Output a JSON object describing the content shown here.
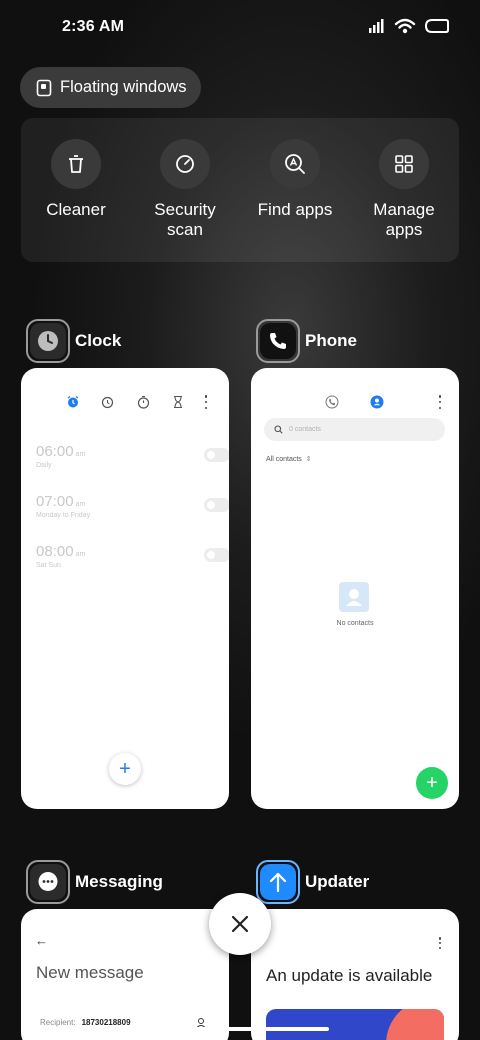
{
  "status_bar": {
    "time": "2:36 AM",
    "icons": [
      "signal-icon",
      "wifi-icon",
      "battery-icon"
    ]
  },
  "floating_windows": {
    "label": "Floating windows",
    "icon": "floating-window-icon"
  },
  "tools": [
    {
      "label": "Cleaner",
      "icon": "trash-icon"
    },
    {
      "label": "Security scan",
      "icon": "security-scan-icon"
    },
    {
      "label": "Find apps",
      "icon": "find-apps-icon"
    },
    {
      "label": "Manage apps",
      "icon": "grid-icon"
    }
  ],
  "apps": {
    "clock": {
      "name": "Clock",
      "tabs": [
        "alarm-icon",
        "clock-icon",
        "stopwatch-icon",
        "timer-icon"
      ],
      "alarms": [
        {
          "time": "06:00",
          "ampm": "am",
          "repeat": "Daily",
          "enabled": false
        },
        {
          "time": "07:00",
          "ampm": "am",
          "repeat": "Monday to Friday",
          "enabled": false
        },
        {
          "time": "08:00",
          "ampm": "am",
          "repeat": "Sat Sun",
          "enabled": false
        }
      ],
      "accent": "#1e7cf0"
    },
    "phone": {
      "name": "Phone",
      "search_placeholder": "0 contacts",
      "filter": "All contacts",
      "empty_text": "No contacts",
      "accent": "#1e7cf0",
      "fab_color": "#25d366"
    },
    "messaging": {
      "name": "Messaging",
      "title": "New message",
      "recipient_label": "Recipient:",
      "recipient_value": "18730218809"
    },
    "updater": {
      "name": "Updater",
      "title": "An update is available"
    }
  }
}
